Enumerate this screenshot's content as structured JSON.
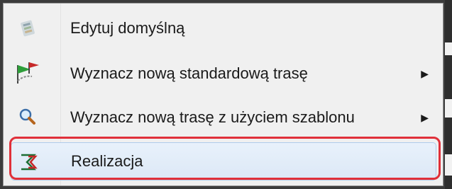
{
  "menu": {
    "items": [
      {
        "label": "Edytuj domyślną",
        "icon": "edit-map-icon",
        "has_submenu": false
      },
      {
        "label": "Wyznacz nową standardową trasę",
        "icon": "route-flags-icon",
        "has_submenu": true,
        "arrow": "▶"
      },
      {
        "label": "Wyznacz nową trasę z użyciem szablonu",
        "icon": "magnifier-icon",
        "has_submenu": true,
        "arrow": "▶"
      },
      {
        "label": "Realizacja",
        "icon": "realization-icon",
        "has_submenu": false,
        "highlighted": true
      }
    ]
  },
  "colors": {
    "highlight_annotation": "#e0303a",
    "hover_fill": "#dce8f6",
    "menu_background": "#f0f0f0"
  }
}
